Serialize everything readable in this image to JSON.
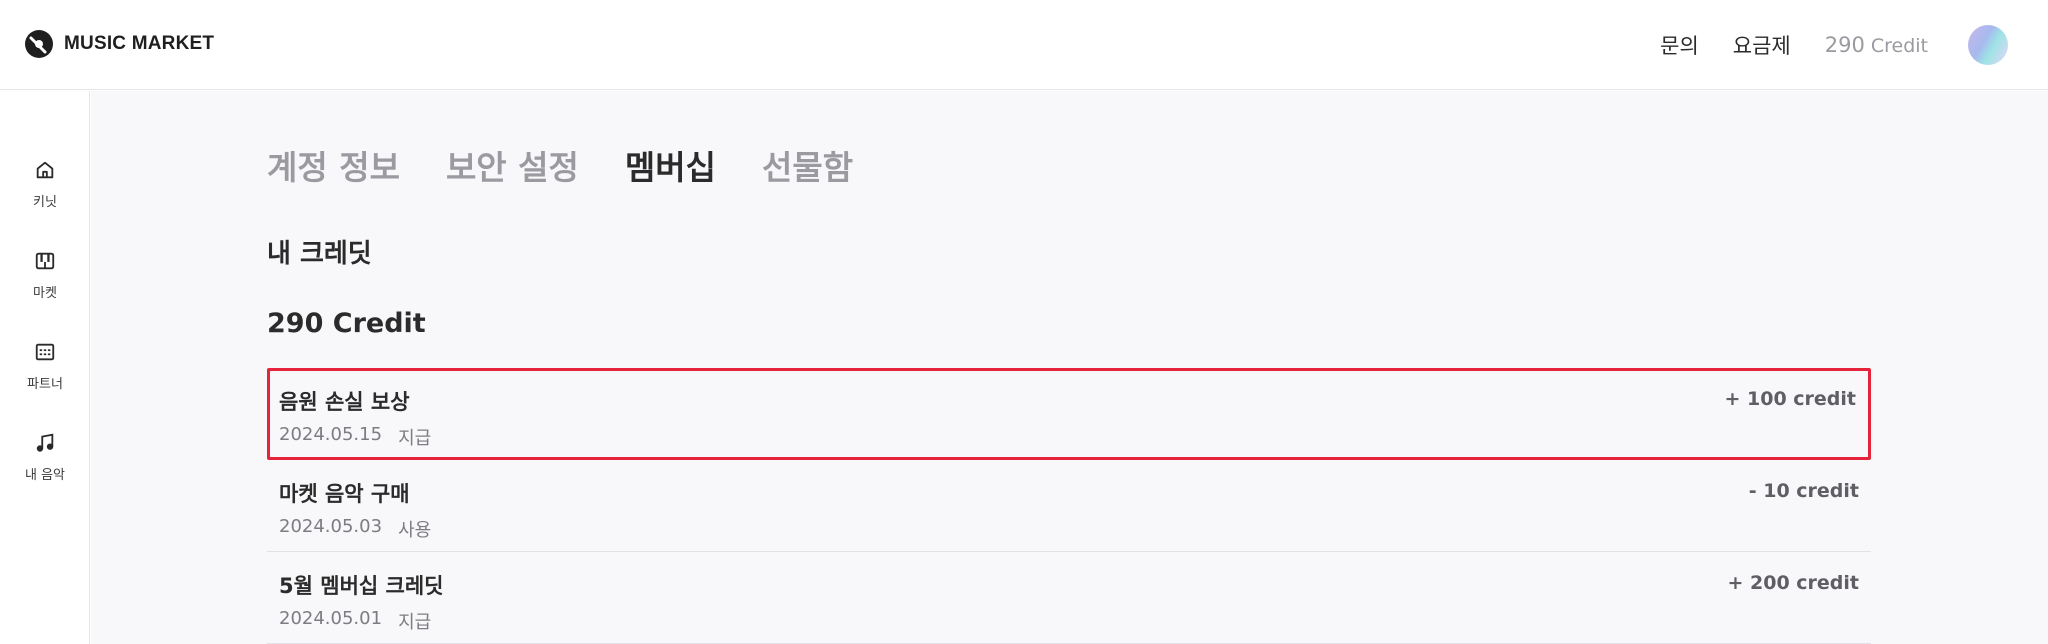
{
  "header": {
    "brand": "MUSIC MARKET",
    "nav": [
      {
        "label": "문의"
      },
      {
        "label": "요금제"
      }
    ],
    "credit_value": "290",
    "credit_unit": "Credit"
  },
  "sidebar": {
    "items": [
      {
        "label": "키닛",
        "icon": "home-icon"
      },
      {
        "label": "마켓",
        "icon": "piano-icon"
      },
      {
        "label": "파트너",
        "icon": "grid-icon"
      },
      {
        "label": "내 음악",
        "icon": "music-note-icon"
      }
    ]
  },
  "main": {
    "tabs": [
      {
        "label": "계정 정보",
        "active": false
      },
      {
        "label": "보안 설정",
        "active": false
      },
      {
        "label": "멤버십",
        "active": true
      },
      {
        "label": "선물함",
        "active": false
      }
    ],
    "section_title": "내 크레딧",
    "credit_total": "290 Credit",
    "transactions": [
      {
        "title": "음원 손실 보상",
        "date": "2024.05.15",
        "type": "지급",
        "amount": "+ 100 credit",
        "highlighted": true
      },
      {
        "title": "마켓 음악 구매",
        "date": "2024.05.03",
        "type": "사용",
        "amount": "- 10 credit",
        "highlighted": false
      },
      {
        "title": "5월 멤버십 크레딧",
        "date": "2024.05.01",
        "type": "지급",
        "amount": "+ 200 credit",
        "highlighted": false
      }
    ]
  },
  "colors": {
    "highlight_border": "#e5233b",
    "main_background": "#f8f8fa",
    "muted_text": "#9a9aa0"
  }
}
